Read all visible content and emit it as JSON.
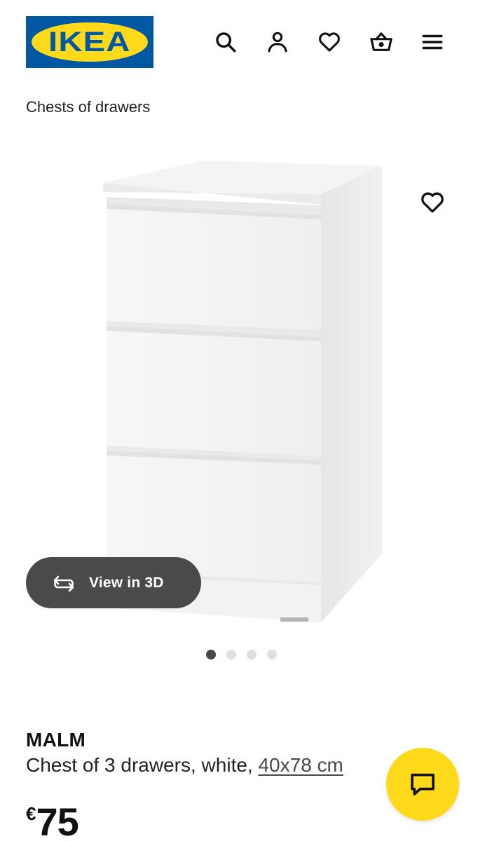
{
  "header": {
    "logo_text": "IKEA",
    "icons": [
      "search-icon",
      "account-icon",
      "favourites-icon",
      "basket-icon",
      "menu-icon"
    ]
  },
  "breadcrumb": {
    "label": "Chests of drawers"
  },
  "gallery": {
    "view3d_label": "View in 3D",
    "image_count": 4,
    "active_image": 1
  },
  "product": {
    "name": "MALM",
    "description": "Chest of 3 drawers, white,",
    "measurement": "40x78 cm",
    "currency": "€",
    "price": "75"
  },
  "colors": {
    "brand_blue": "#0058a3",
    "brand_yellow": "#ffda1a",
    "pill_bg": "#4a4a4a"
  }
}
